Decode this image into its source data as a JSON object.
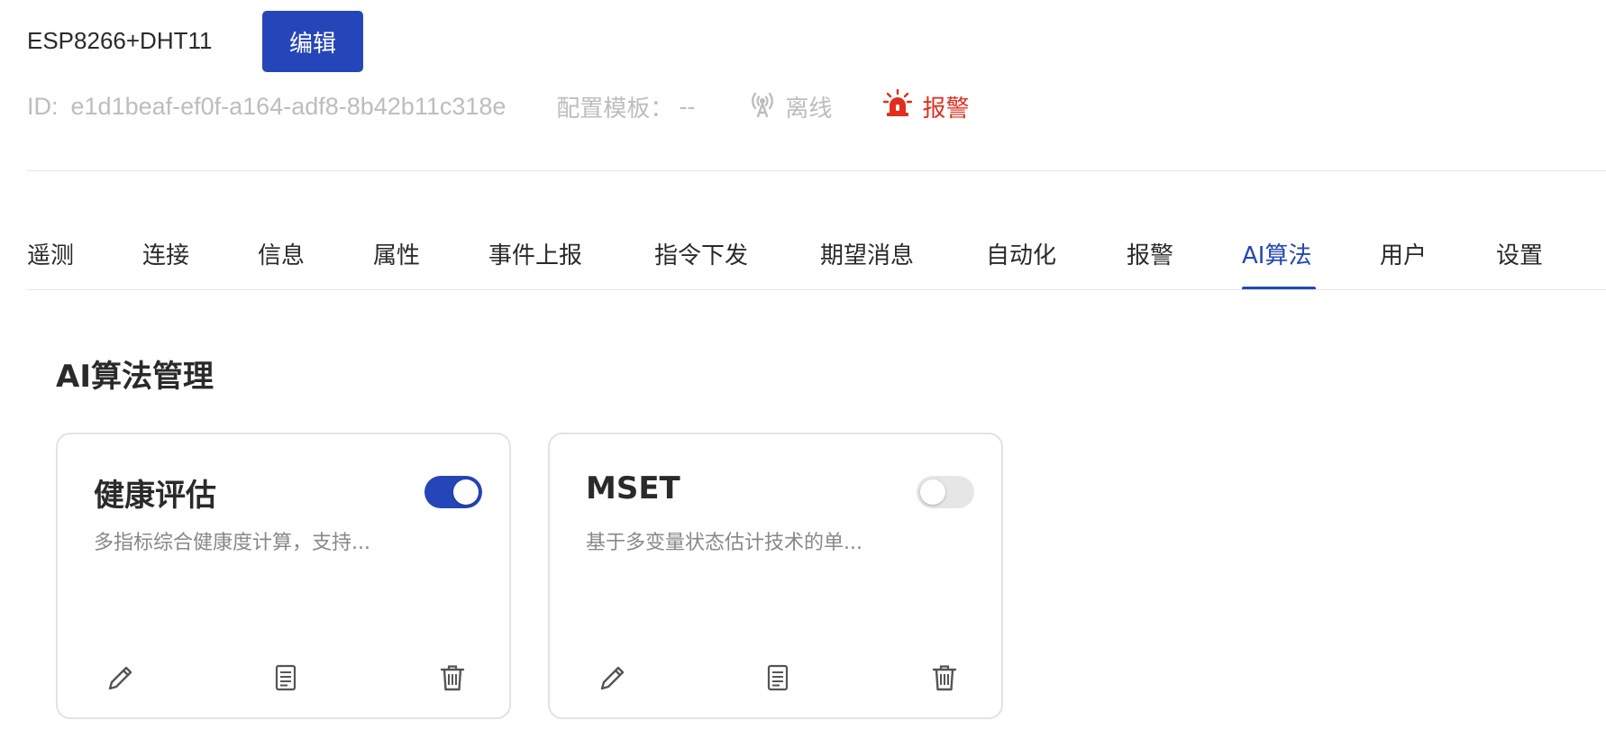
{
  "header": {
    "device_name": "ESP8266+DHT11",
    "edit_label": "编辑",
    "id_label": "ID:",
    "id_value": "e1d1beaf-ef0f-a164-adf8-8b42b11c318e",
    "template_label": "配置模板：",
    "template_value": "--",
    "status_offline": "离线",
    "status_alarm": "报警"
  },
  "tabs": [
    {
      "label": "遥测",
      "active": false
    },
    {
      "label": "连接",
      "active": false
    },
    {
      "label": "信息",
      "active": false
    },
    {
      "label": "属性",
      "active": false
    },
    {
      "label": "事件上报",
      "active": false
    },
    {
      "label": "指令下发",
      "active": false
    },
    {
      "label": "期望消息",
      "active": false
    },
    {
      "label": "自动化",
      "active": false
    },
    {
      "label": "报警",
      "active": false
    },
    {
      "label": "AI算法",
      "active": true
    },
    {
      "label": "用户",
      "active": false
    },
    {
      "label": "设置",
      "active": false
    }
  ],
  "section": {
    "title": "AI算法管理"
  },
  "cards": [
    {
      "title": "健康评估",
      "description": "多指标综合健康度计算，支持...",
      "enabled": true
    },
    {
      "title": "MSET",
      "description": "基于多变量状态估计技术的单...",
      "enabled": false
    }
  ],
  "colors": {
    "primary": "#2446b8",
    "alarm": "#e02e1f",
    "muted": "#bdbdbd"
  },
  "icons": {
    "edit": "pencil-icon",
    "doc": "document-icon",
    "delete": "trash-icon",
    "offline": "antenna-icon",
    "alarm": "siren-icon"
  }
}
